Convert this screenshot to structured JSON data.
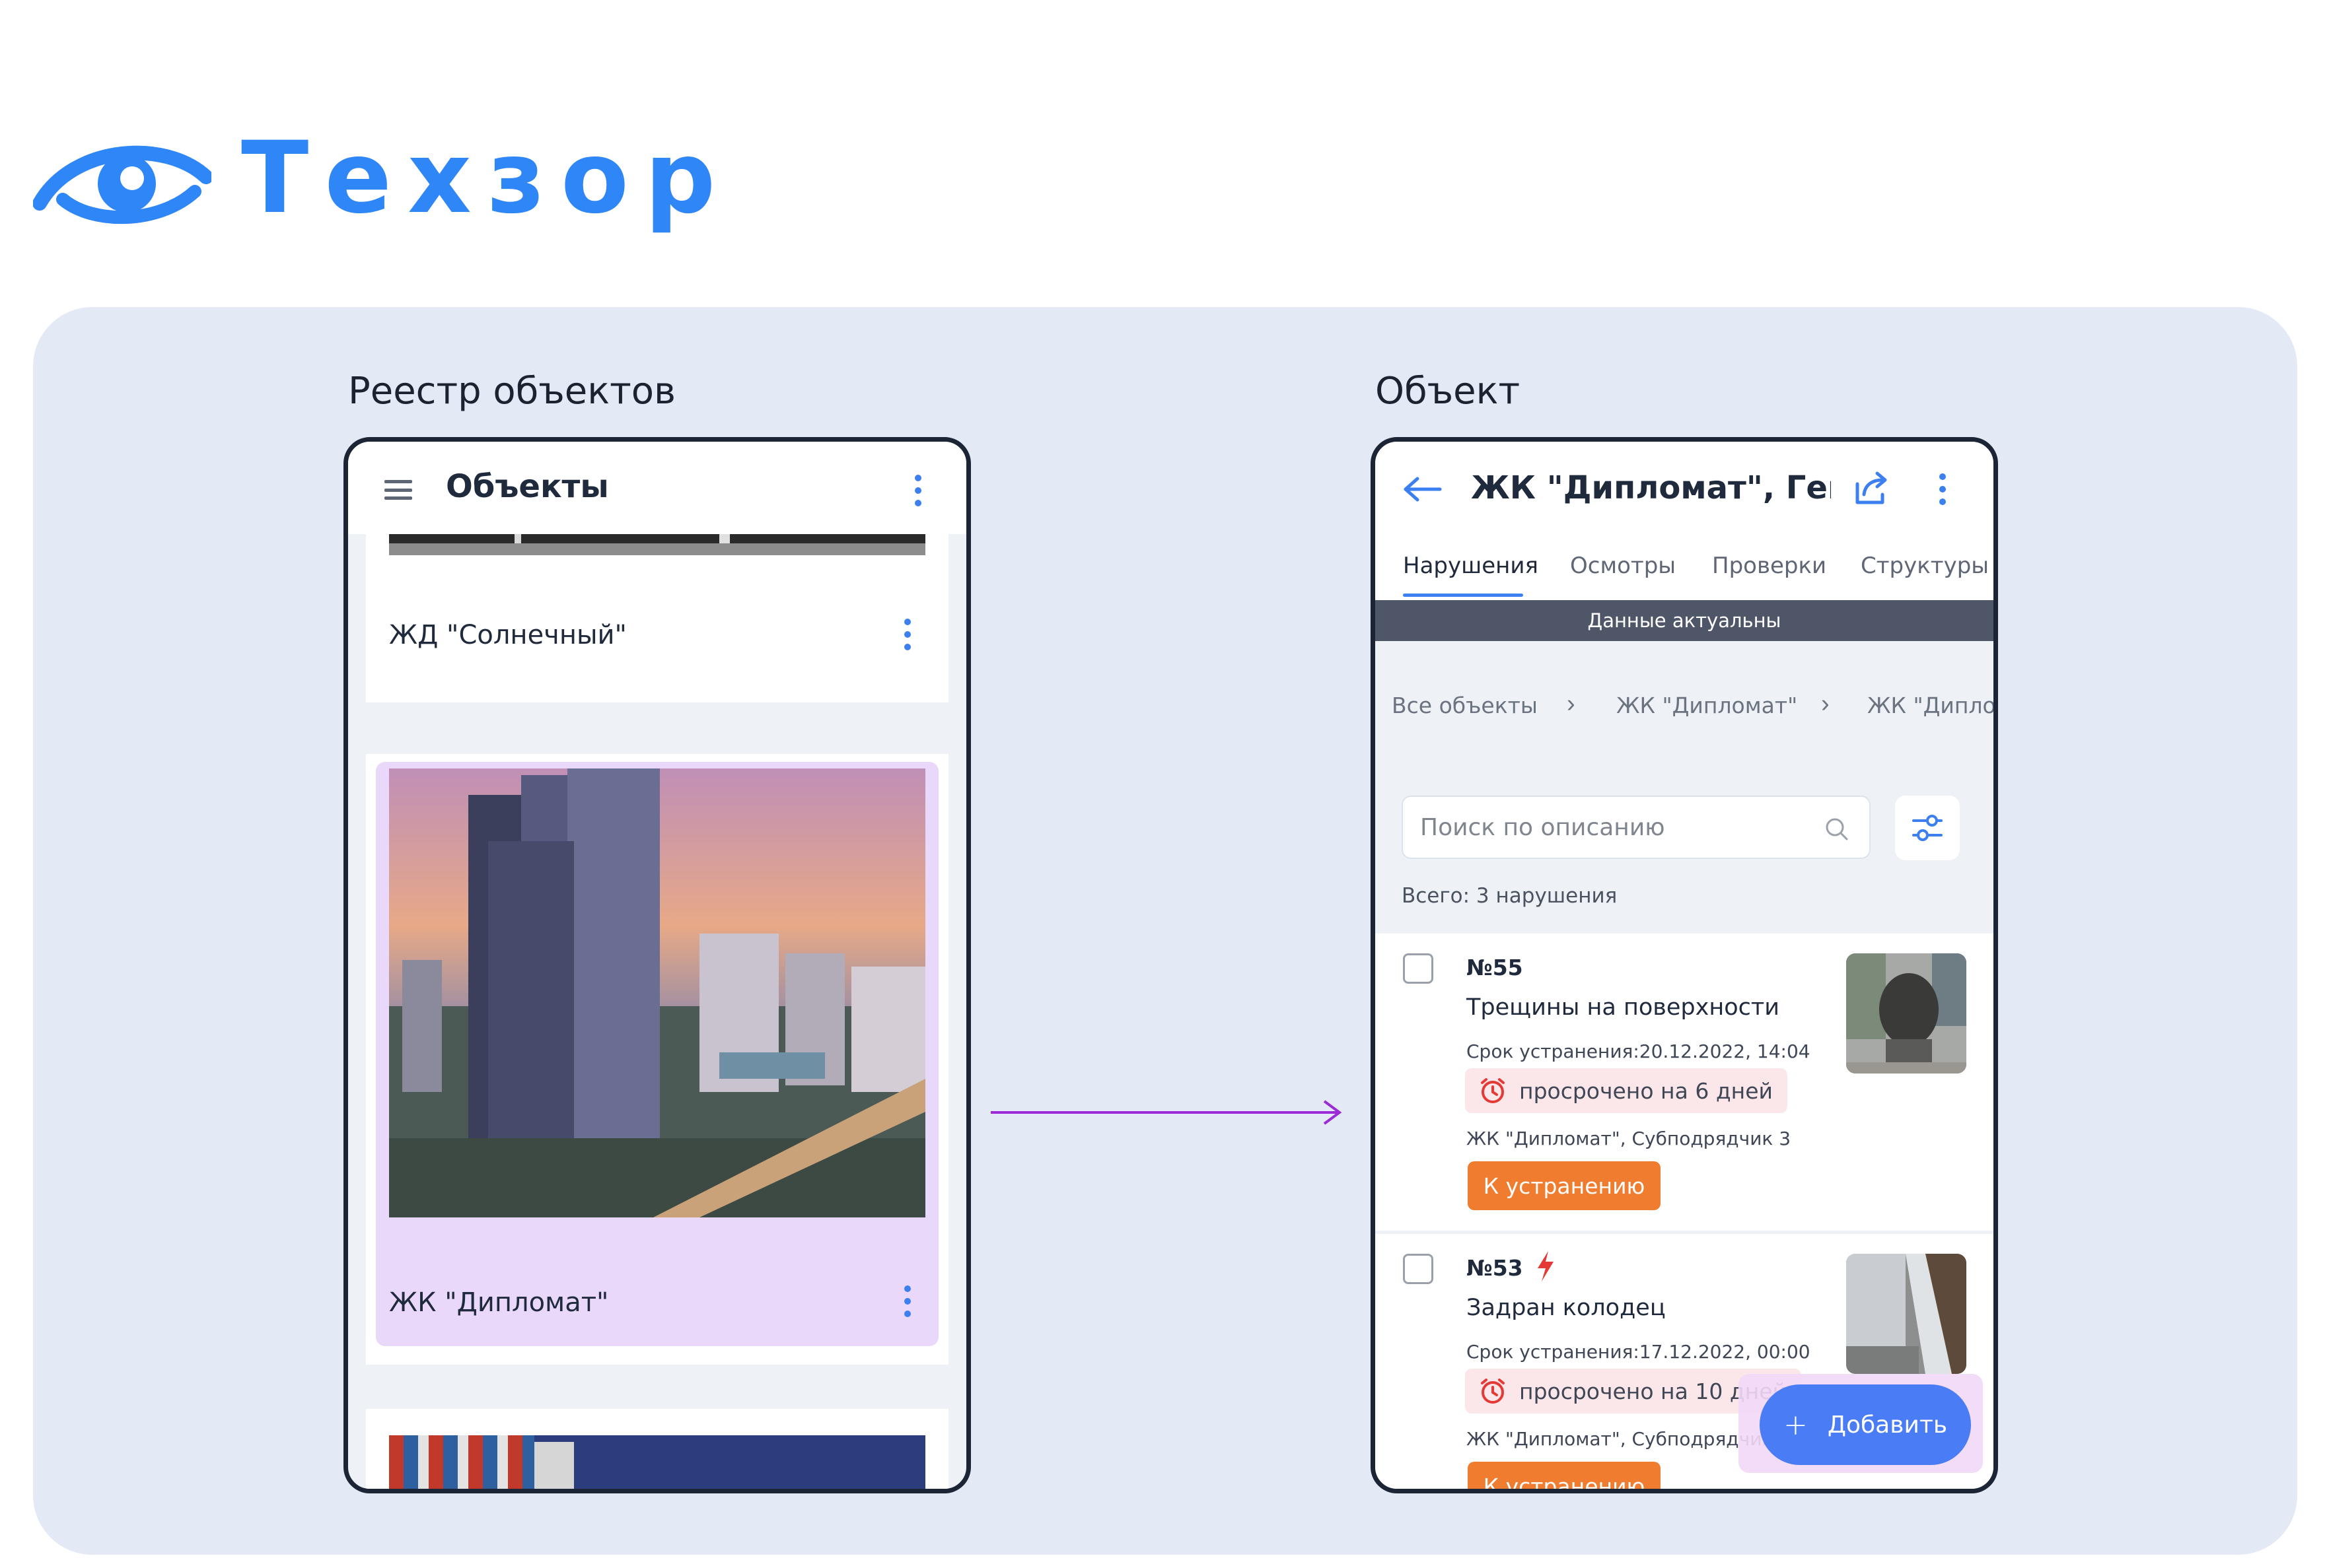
{
  "brand": {
    "name": "Техзор",
    "color": "#2f86f6"
  },
  "left_screen": {
    "caption": "Реестр объектов",
    "appbar_title": "Объекты",
    "objects": [
      {
        "name": "ЖД \"Солнечный\""
      },
      {
        "name": "ЖК \"Дипломат\"",
        "selected": true
      },
      {
        "name": ""
      }
    ]
  },
  "right_screen": {
    "caption": "Объект",
    "title": "ЖК \"Дипломат\", Генп.",
    "tabs": [
      "Нарушения",
      "Осмотры",
      "Проверки",
      "Структуры"
    ],
    "active_tab": "Нарушения",
    "status_bar": "Данные актуальны",
    "breadcrumbs": [
      "Все объекты",
      "ЖК \"Дипломат\"",
      "ЖК \"Диплом"
    ],
    "search": {
      "placeholder": "Поиск по описанию",
      "value": ""
    },
    "total": "Всего: 3 нарушения",
    "violations": [
      {
        "number": "№55",
        "title": "Трещины на поверхности",
        "deadline": "Срок устранения:20.12.2022, 14:04",
        "overdue": "просрочено на 6 дней",
        "org": "ЖК \"Дипломат\", Субподрядчик 3",
        "status": "К устранению",
        "urgent": false
      },
      {
        "number": "№53",
        "title": "Задран колодец",
        "deadline": "Срок устранения:17.12.2022, 00:00",
        "overdue": "просрочено на 10 дней",
        "org": "ЖК \"Дипломат\", Субподрядчик 3",
        "status": "К устранению",
        "urgent": true
      }
    ],
    "fab_label": "Добавить",
    "fab_plus": "+"
  },
  "colors": {
    "accent": "#3b7ff0",
    "status_orange": "#f07c2f",
    "overdue_bg": "#fbe7e9",
    "overdue_icon": "#e53935",
    "selected_card": "#ead8fb",
    "flow_arrow": "#9b2bd6"
  },
  "icons": [
    "eye-logo-icon",
    "hamburger-icon",
    "kebab-menu-icon",
    "back-arrow-icon",
    "share-icon",
    "search-icon",
    "filter-icon",
    "alarm-clock-icon",
    "lightning-icon",
    "plus-icon"
  ]
}
